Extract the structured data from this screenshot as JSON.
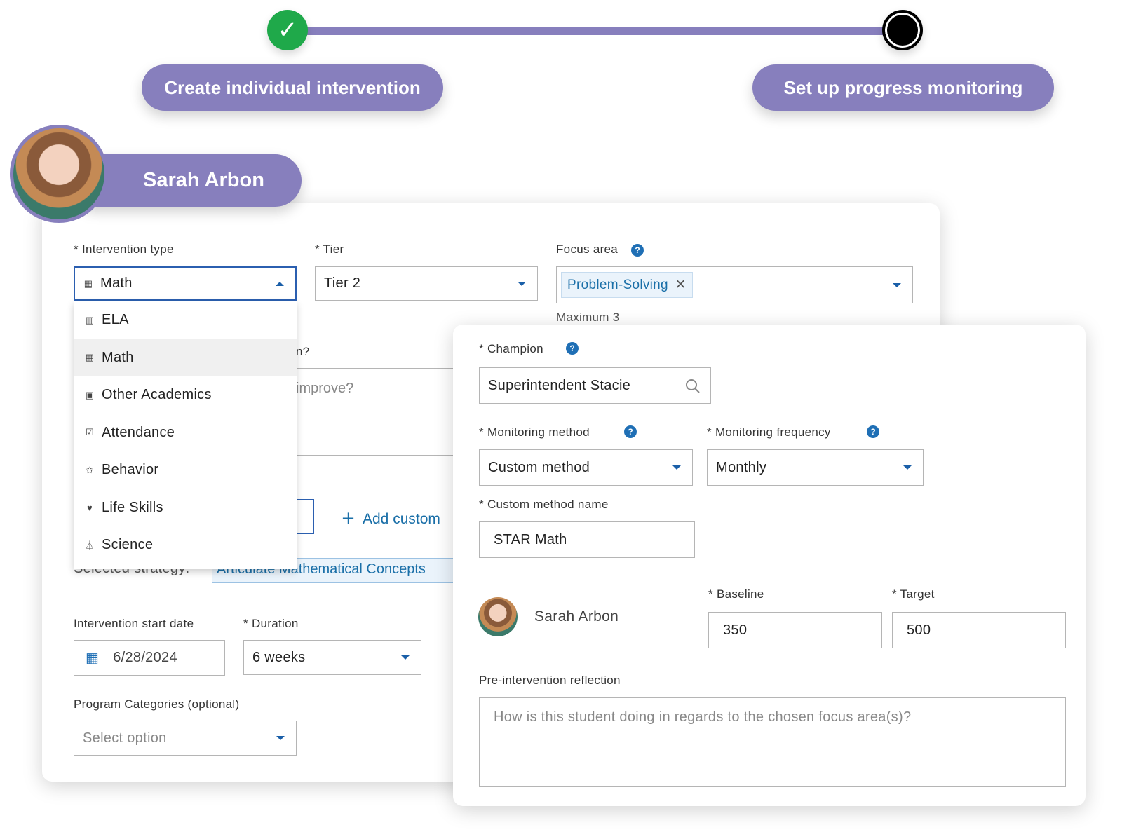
{
  "stepper": {
    "steps": [
      {
        "label": "Create individual intervention",
        "status": "complete",
        "icon": "check-icon"
      },
      {
        "label": "Set up progress monitoring",
        "status": "current"
      }
    ],
    "colors": {
      "accent": "#877fbd",
      "complete": "#1fa94a"
    }
  },
  "student": {
    "name": "Sarah Arbon"
  },
  "intervention_form": {
    "intervention_type": {
      "label": "* Intervention type",
      "value": "Math",
      "icon": "calculator-icon",
      "options": [
        {
          "label": "ELA",
          "icon": "books-icon"
        },
        {
          "label": "Math",
          "icon": "calculator-icon",
          "selected": true
        },
        {
          "label": "Other Academics",
          "icon": "grade-icon"
        },
        {
          "label": "Attendance",
          "icon": "checkbox-icon"
        },
        {
          "label": "Behavior",
          "icon": "star-icon"
        },
        {
          "label": "Life Skills",
          "icon": "heart-icon"
        },
        {
          "label": "Science",
          "icon": "flask-icon"
        }
      ]
    },
    "tier": {
      "label": "* Tier",
      "value": "Tier 2"
    },
    "focus_area": {
      "label": "Focus area",
      "chip": "Problem-Solving",
      "hint": "Maximum 3"
    },
    "partial_question": "n?",
    "partial_placeholder": "improve?",
    "add_custom": "Add custom",
    "selected_strategy_label": "Selected strategy:",
    "selected_strategy": "Articulate Mathematical Concepts",
    "start_date": {
      "label": "Intervention start date",
      "value": "6/28/2024"
    },
    "duration": {
      "label": "* Duration",
      "value": "6 weeks"
    },
    "program_categories": {
      "label": "Program Categories (optional)",
      "placeholder": "Select option"
    }
  },
  "monitoring_form": {
    "champion": {
      "label": "* Champion",
      "value": "Superintendent Stacie"
    },
    "method": {
      "label": "* Monitoring method",
      "value": "Custom method"
    },
    "frequency": {
      "label": "* Monitoring frequency",
      "value": "Monthly"
    },
    "custom_method_name": {
      "label": "* Custom method name",
      "value": "STAR Math"
    },
    "student_name": "Sarah Arbon",
    "baseline": {
      "label": "* Baseline",
      "value": "350"
    },
    "target": {
      "label": "* Target",
      "value": "500"
    },
    "reflection": {
      "label": "Pre-intervention reflection",
      "placeholder": "How is this student doing in regards to the chosen focus area(s)?"
    }
  }
}
